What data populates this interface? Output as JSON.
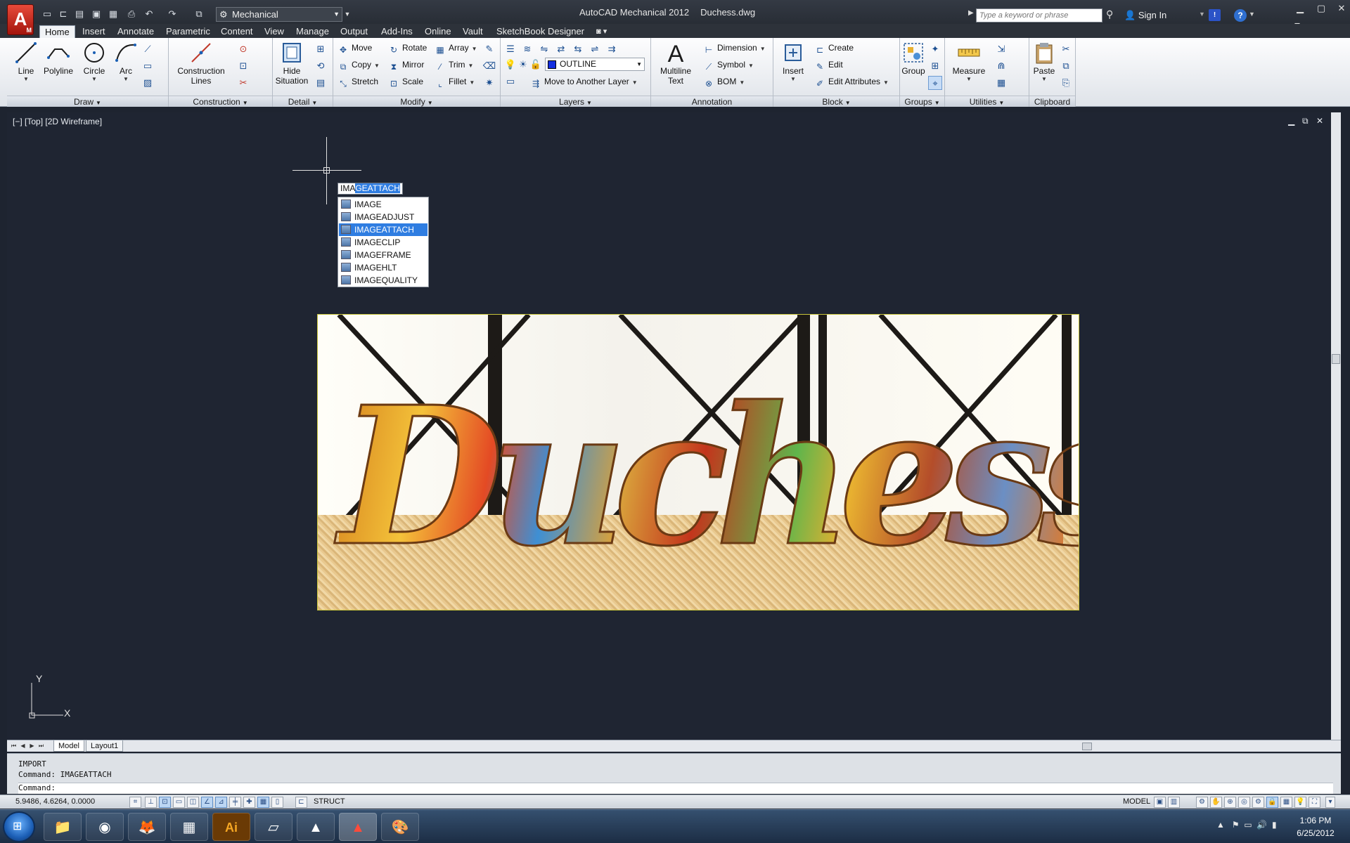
{
  "app": {
    "logo_letter": "A",
    "logo_sub": "M",
    "product": "AutoCAD Mechanical 2012",
    "file": "Duchess.dwg",
    "workspace": "Mechanical",
    "search_placeholder": "Type a keyword or phrase",
    "sign_in": "Sign In"
  },
  "ribbon": {
    "tabs": [
      "Home",
      "Insert",
      "Annotate",
      "Parametric",
      "Content",
      "View",
      "Manage",
      "Output",
      "Add-Ins",
      "Online",
      "Vault",
      "SketchBook Designer"
    ],
    "active_tab": "Home",
    "panels": {
      "draw": {
        "title": "Draw",
        "tools": [
          "Line",
          "Polyline",
          "Circle",
          "Arc"
        ]
      },
      "construction": {
        "title": "Construction",
        "tool": "Construction",
        "tool2": "Lines"
      },
      "detail": {
        "title": "Detail",
        "tool": "Hide",
        "tool2": "Situation"
      },
      "modify": {
        "title": "Modify",
        "tools": [
          [
            "Move",
            "Rotate",
            "Array"
          ],
          [
            "Copy",
            "Mirror",
            "Trim"
          ],
          [
            "Stretch",
            "Scale",
            "Fillet"
          ]
        ]
      },
      "layers": {
        "title": "Layers",
        "current_layer": "OUTLINE",
        "move_layer": "Move to Another Layer",
        "layer_color": "#1530e0"
      },
      "annotation": {
        "title": "Annotation",
        "mtext": "Multiline",
        "mtext2": "Text",
        "tools": [
          "Dimension",
          "Symbol",
          "BOM"
        ]
      },
      "block": {
        "title": "Block",
        "insert": "Insert",
        "tools": [
          "Create",
          "Edit",
          "Edit Attributes"
        ]
      },
      "groups": {
        "title": "Groups",
        "tool": "Group"
      },
      "utilities": {
        "title": "Utilities",
        "tool": "Measure"
      },
      "clipboard": {
        "title": "Clipboard",
        "tool": "Paste"
      }
    }
  },
  "viewport": {
    "label": "[−] [Top] [2D Wireframe]",
    "typed_prefix": "IMA",
    "typed_completion": "GEATTACH",
    "autocomplete": [
      "IMAGE",
      "IMAGEADJUST",
      "IMAGEATTACH",
      "IMAGECLIP",
      "IMAGEFRAME",
      "IMAGEHLT",
      "IMAGEQUALITY"
    ],
    "autocomplete_selected": "IMAGEATTACH",
    "image_text": "Duchess",
    "ucs_x": "X",
    "ucs_y": "Y"
  },
  "layout_tabs": [
    "Model",
    "Layout1"
  ],
  "command_line": {
    "history": [
      "IMPORT",
      "Command: IMAGEATTACH"
    ],
    "prompt": "Command:"
  },
  "status": {
    "coords": "5.9486, 4.6264, 0.0000",
    "struct": "STRUCT",
    "model": "MODEL"
  },
  "taskbar": {
    "time": "1:06 PM",
    "date": "6/25/2012",
    "apps": [
      "explorer",
      "chrome",
      "firefox",
      "calculator",
      "illustrator",
      "paper",
      "autocad-2012",
      "autocad-mechanical",
      "paint"
    ]
  }
}
